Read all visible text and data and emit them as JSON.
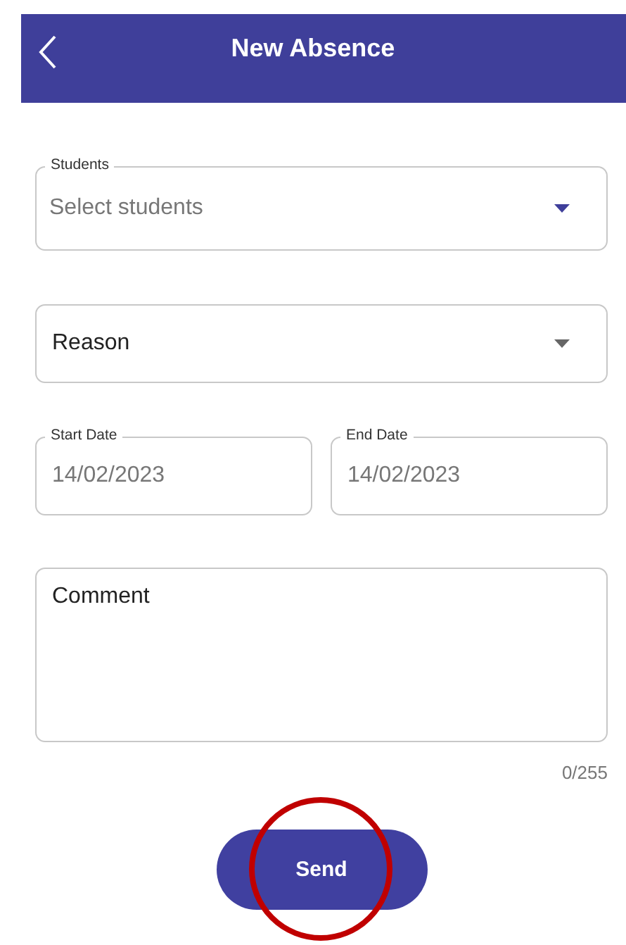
{
  "header": {
    "title": "New Absence"
  },
  "fields": [
    {
      "kind": "dropdown",
      "label": "Students",
      "placeholder": "Select students",
      "focused": true
    },
    {
      "kind": "dropdown",
      "label": "Reason",
      "focused": false
    },
    {
      "kind": "date",
      "label": "Start Date",
      "value": "14/02/2023"
    },
    {
      "kind": "date",
      "label": "End Date",
      "value": "14/02/2023"
    },
    {
      "kind": "textarea",
      "label": "Comment",
      "counter": "0/255"
    }
  ],
  "button": {
    "label": "Send",
    "highlighted": true
  }
}
